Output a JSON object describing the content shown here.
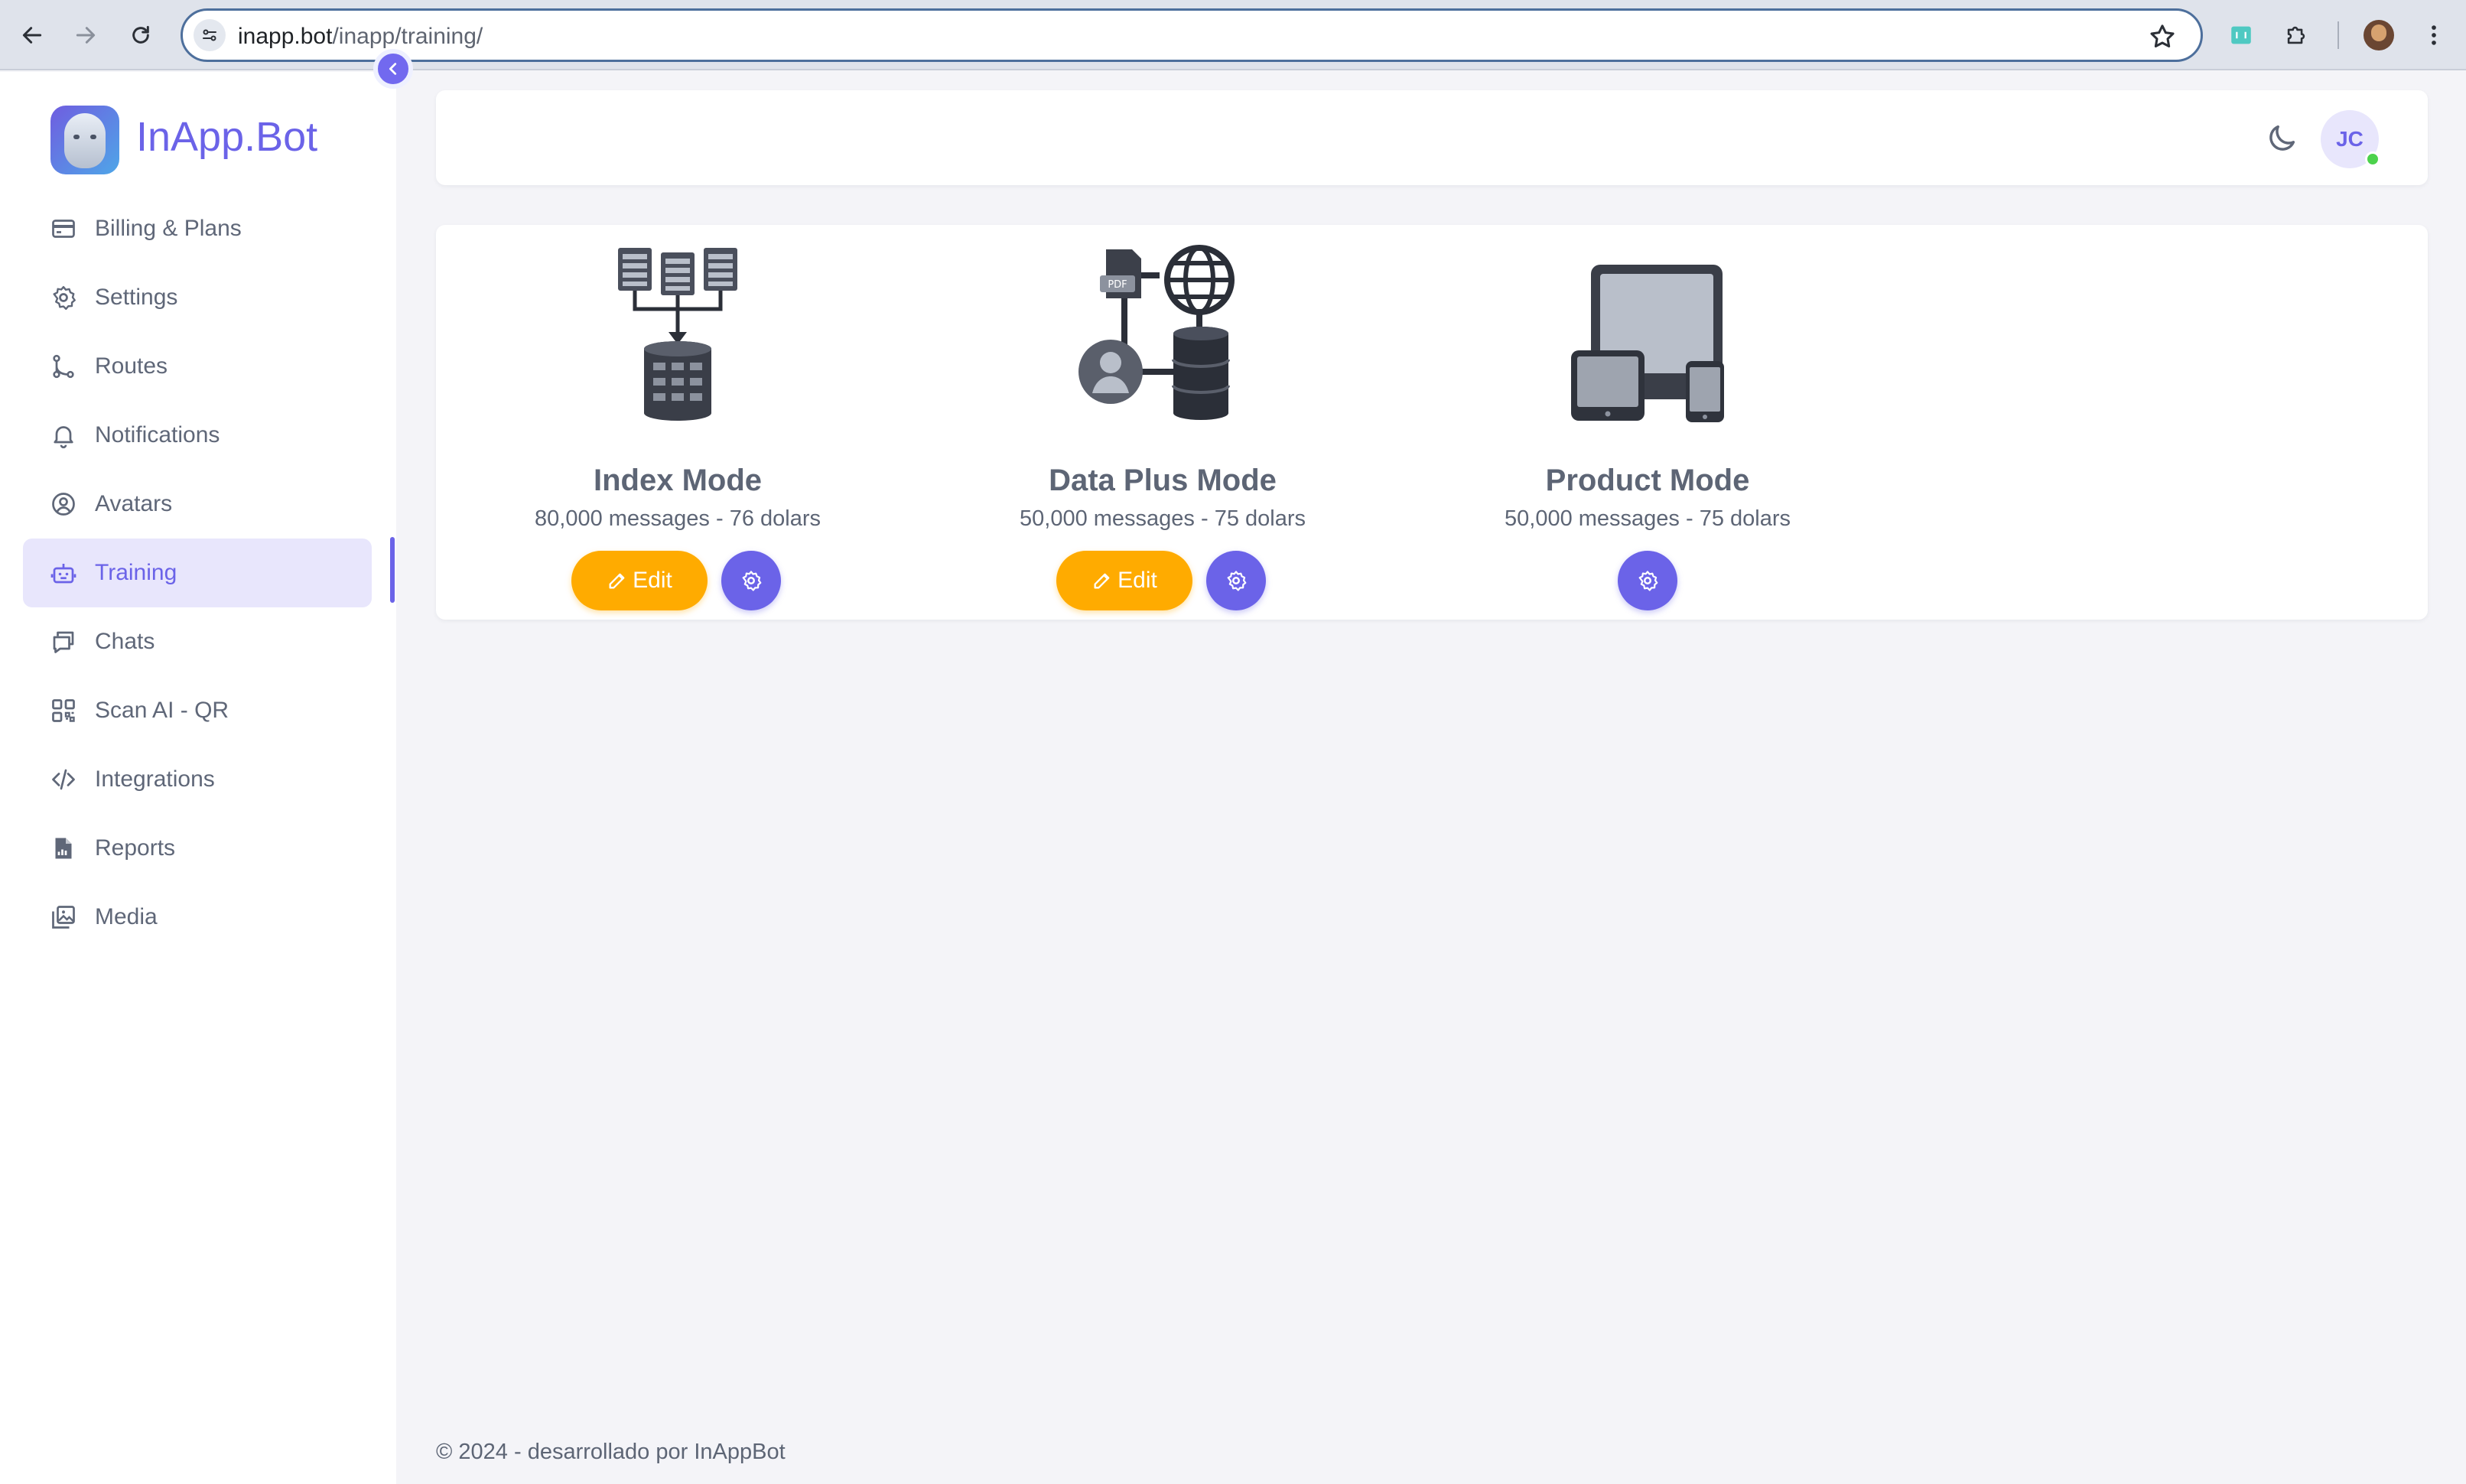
{
  "browser": {
    "url_host": "inapp.bot",
    "url_path": "/inapp/training/",
    "icons": [
      "back-arrow-icon",
      "forward-arrow-icon",
      "reload-icon",
      "site-settings-icon",
      "bookmark-star-icon",
      "extension-icon",
      "puzzle-extensions-icon",
      "profile-avatar",
      "kebab-menu-icon"
    ]
  },
  "sidebar": {
    "brand": "InApp.Bot",
    "items": [
      {
        "label": "Billing & Plans",
        "icon": "credit-card-icon"
      },
      {
        "label": "Settings",
        "icon": "gear-icon"
      },
      {
        "label": "Routes",
        "icon": "git-branch-icon"
      },
      {
        "label": "Notifications",
        "icon": "bell-icon"
      },
      {
        "label": "Avatars",
        "icon": "user-circle-icon"
      },
      {
        "label": "Training",
        "icon": "robot-icon",
        "active": true
      },
      {
        "label": "Chats",
        "icon": "chat-bubbles-icon"
      },
      {
        "label": "Scan AI - QR",
        "icon": "qr-code-icon"
      },
      {
        "label": "Integrations",
        "icon": "code-icon"
      },
      {
        "label": "Reports",
        "icon": "report-file-icon"
      },
      {
        "label": "Media",
        "icon": "image-gallery-icon"
      }
    ]
  },
  "header": {
    "avatar_initials": "JC",
    "status": "online"
  },
  "modes": [
    {
      "title": "Index Mode",
      "subtitle": "80,000 messages - 76 dolars",
      "edit_label": "Edit",
      "has_edit": true
    },
    {
      "title": "Data Plus Mode",
      "subtitle": "50,000 messages - 75 dolars",
      "edit_label": "Edit",
      "has_edit": true
    },
    {
      "title": "Product Mode",
      "subtitle": "50,000 messages - 75 dolars",
      "has_edit": false
    }
  ],
  "footer": {
    "text": "© 2024 - desarrollado por InAppBot"
  },
  "colors": {
    "accent": "#6b63e8",
    "edit_button": "#ffab00",
    "online": "#4cd24c"
  }
}
